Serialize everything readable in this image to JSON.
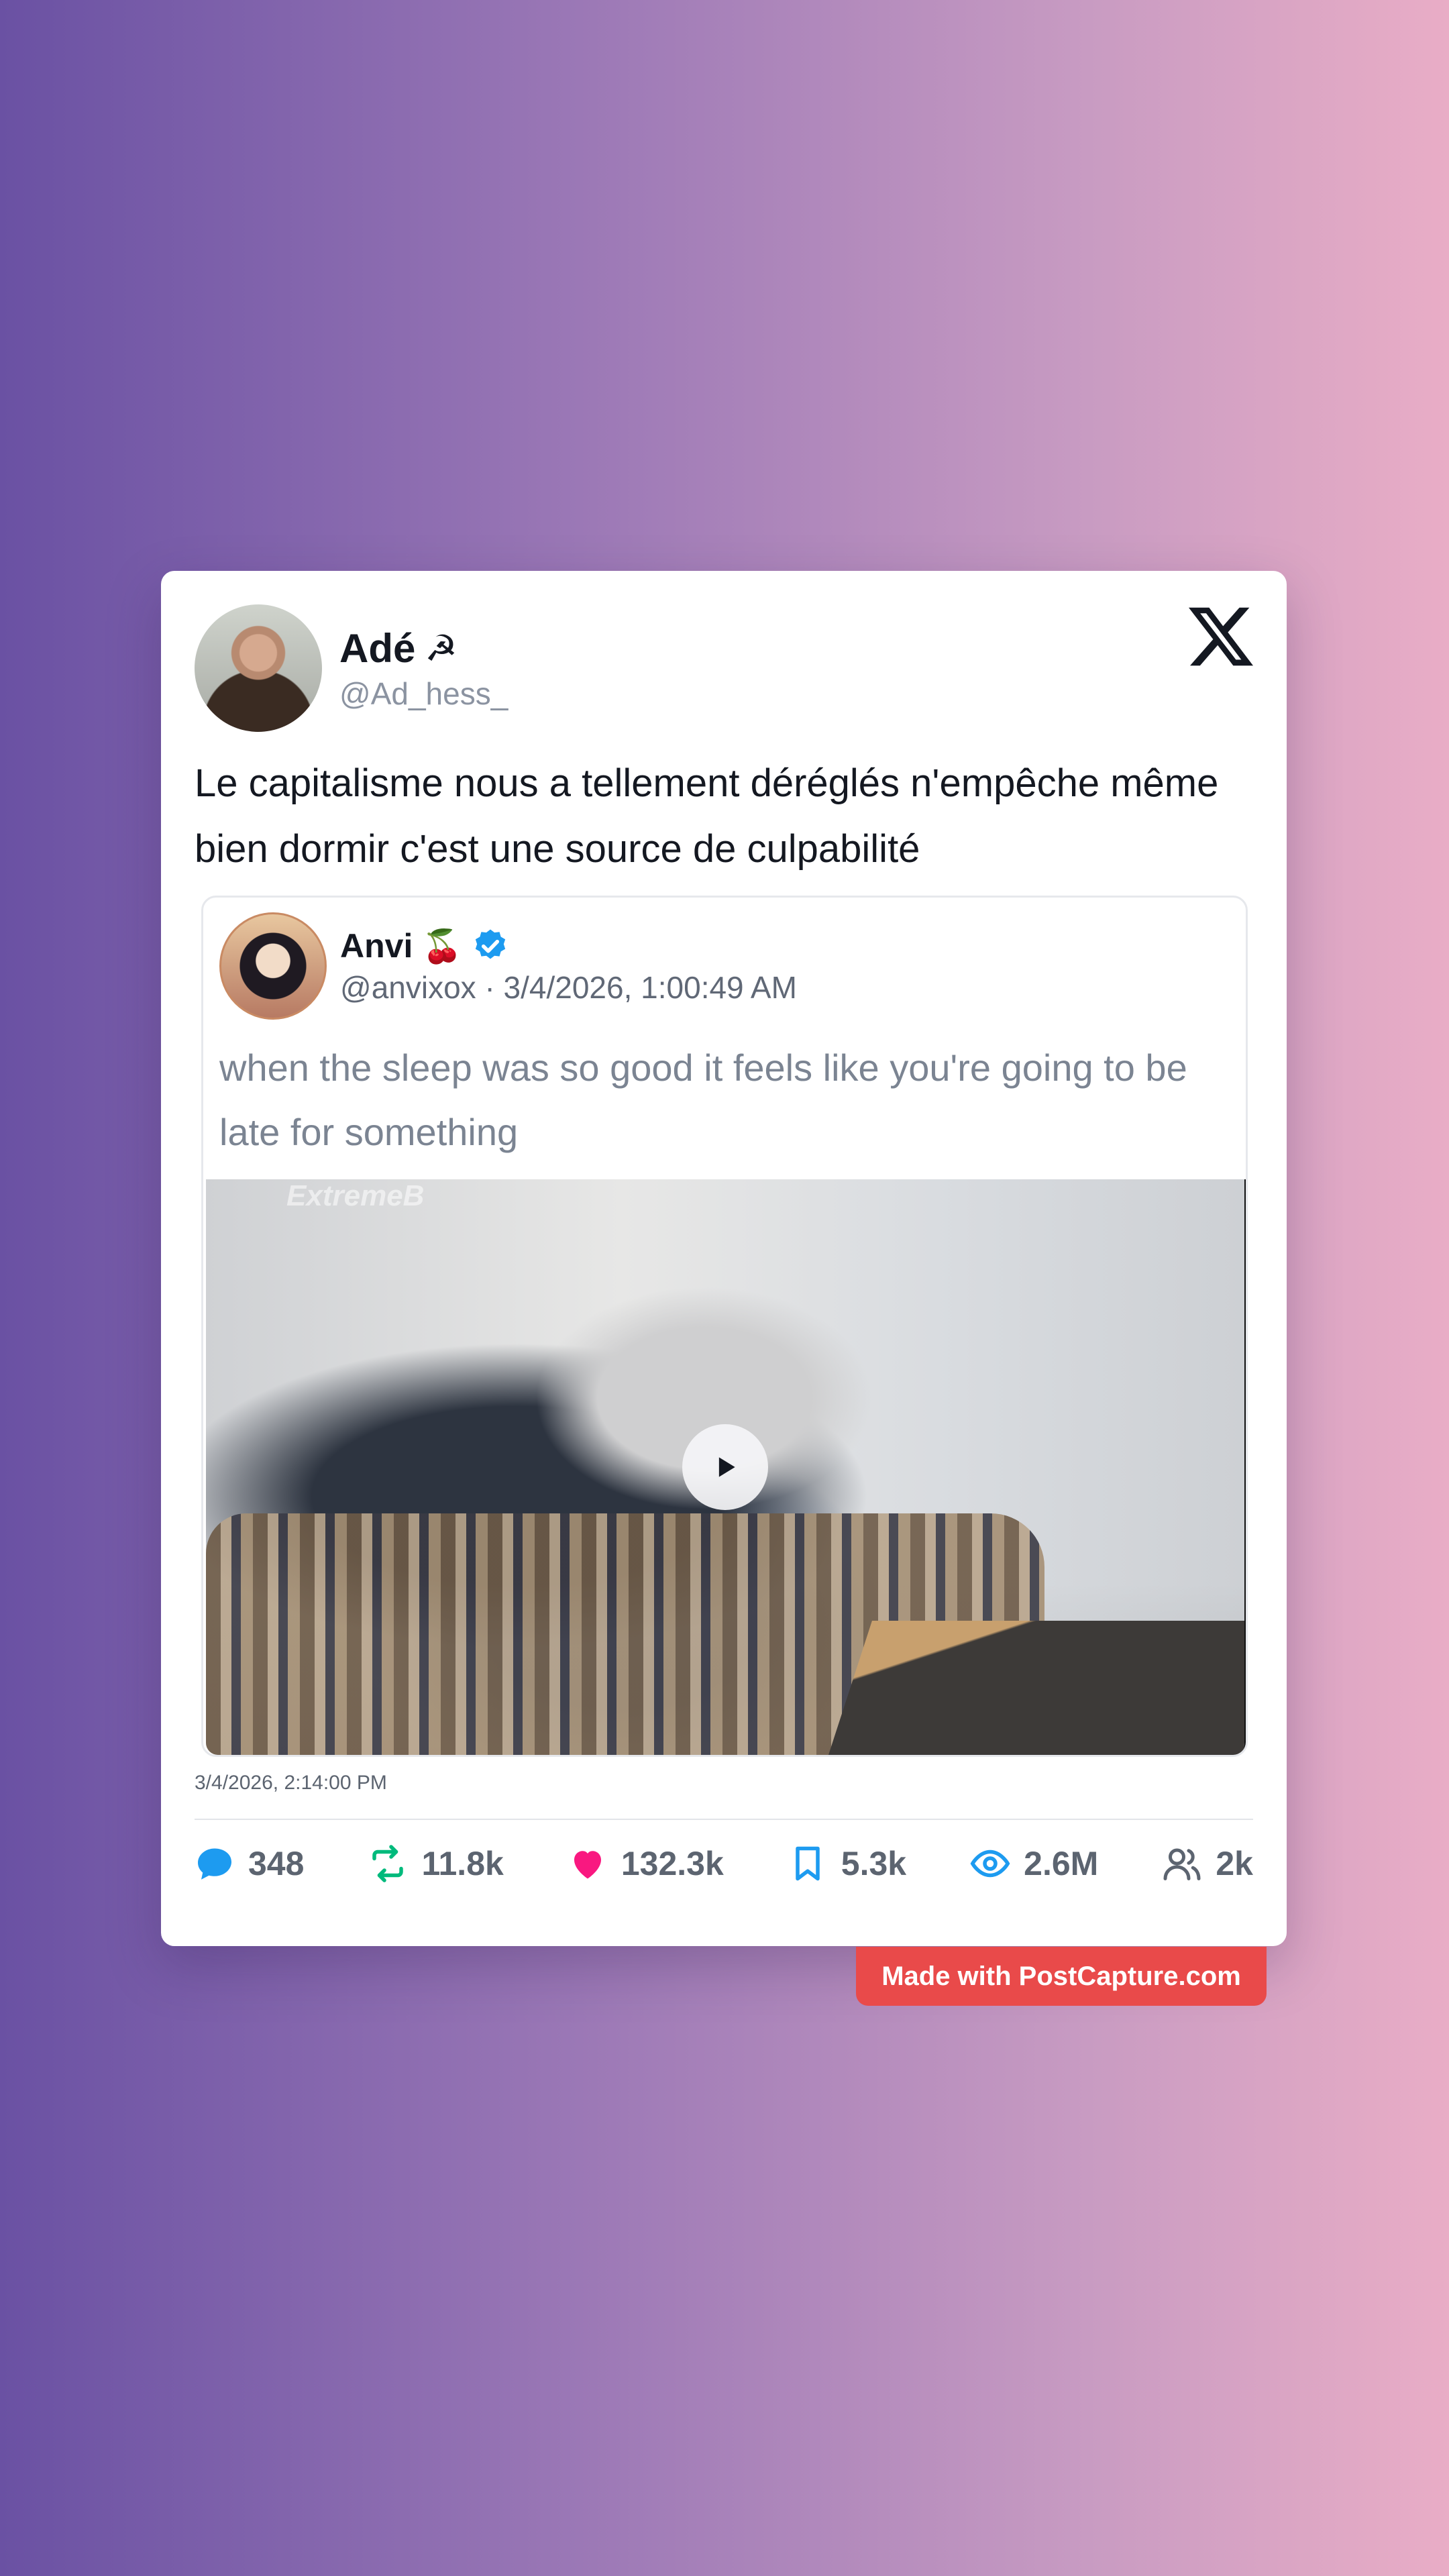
{
  "author": {
    "name": "Adé",
    "emoji": "☭",
    "handle": "@Ad_hess_"
  },
  "tweet": {
    "text": "Le capitalisme nous a tellement déréglés n'empêche même bien dormir c'est une source de culpabilité",
    "timestamp": "3/4/2026, 2:14:00 PM"
  },
  "quoted": {
    "name": "Anvi",
    "emoji": "🍒",
    "meta": "@anvixox · 3/4/2026, 1:00:49 AM",
    "text": "when the sleep was so good it feels like you're going to be late for something",
    "media_watermark": "ExtremeB"
  },
  "stats": {
    "replies": "348",
    "retweets": "11.8k",
    "likes": "132.3k",
    "bookmarks": "5.3k",
    "views": "2.6M",
    "followers": "2k"
  },
  "colors": {
    "reply": "#1d9bf0",
    "retweet": "#00ba7c",
    "like": "#f91880",
    "bookmark": "#1d9bf0",
    "views": "#1d9bf0",
    "badge": "#e94a4a"
  },
  "badge": "Made with PostCapture.com"
}
